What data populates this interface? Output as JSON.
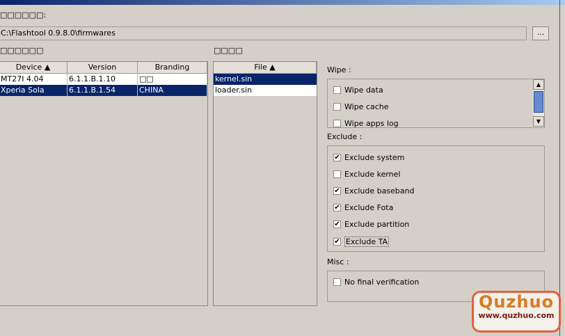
{
  "folder_label": "□□□□□□:",
  "path_value": "C:\\Flashtool 0.9.8.0\\firmwares",
  "browse_label": "...",
  "devices_label": "□□□□□□",
  "files_label": "□□□□",
  "device_table": {
    "headers": [
      "Device ▲",
      "Version",
      "Branding"
    ],
    "rows": [
      [
        "MT27I 4.04",
        "6.1.1.B.1.10",
        "□□"
      ],
      [
        "Xperia Sola",
        "6.1.1.B.1.54",
        "CHINA"
      ]
    ],
    "selected_row": 1
  },
  "file_table": {
    "header": "File ▲",
    "rows": [
      "kernel.sin",
      "loader.sin"
    ],
    "selected_row": 0
  },
  "wipe": {
    "label": "Wipe :",
    "items": [
      {
        "label": "Wipe data",
        "checked": false
      },
      {
        "label": "Wipe cache",
        "checked": false
      },
      {
        "label": "Wipe apps log",
        "checked": false
      }
    ]
  },
  "exclude": {
    "label": "Exclude :",
    "items": [
      {
        "label": "Exclude system",
        "checked": true
      },
      {
        "label": "Exclude kernel",
        "checked": false
      },
      {
        "label": "Exclude baseband",
        "checked": true
      },
      {
        "label": "Exclude Fota",
        "checked": true
      },
      {
        "label": "Exclude partition",
        "checked": true
      },
      {
        "label": "Exclude TA",
        "checked": true
      }
    ]
  },
  "misc": {
    "label": "Misc :",
    "items": [
      {
        "label": "No final verification",
        "checked": false
      }
    ]
  },
  "watermark": {
    "brand": "Quzhuo",
    "url": "www.quzhuo.com"
  }
}
